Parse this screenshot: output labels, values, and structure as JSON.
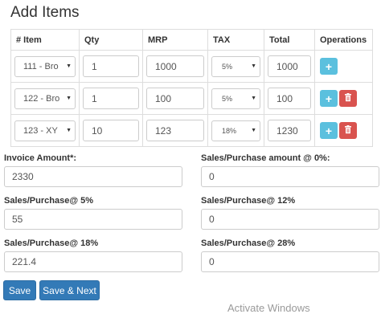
{
  "page": {
    "title": "Add Items"
  },
  "table": {
    "headers": [
      "# Item",
      "Qty",
      "MRP",
      "TAX",
      "Total",
      "Operations"
    ],
    "rows": [
      {
        "item": "111 - Bro",
        "qty": "1",
        "mrp": "1000",
        "tax": "5%",
        "total": "1000",
        "show_delete": false
      },
      {
        "item": "122 - Bro",
        "qty": "1",
        "mrp": "100",
        "tax": "5%",
        "total": "100",
        "show_delete": true
      },
      {
        "item": "123 - XY",
        "qty": "10",
        "mrp": "123",
        "tax": "18%",
        "total": "1230",
        "show_delete": true
      }
    ],
    "add_label": "+"
  },
  "form": {
    "invoice_amount": {
      "label": "Invoice Amount*:",
      "value": "2330"
    },
    "sales_0": {
      "label": "Sales/Purchase amount @ 0%:",
      "value": "0"
    },
    "sales_5": {
      "label": "Sales/Purchase@ 5%",
      "value": "55"
    },
    "sales_12": {
      "label": "Sales/Purchase@ 12%",
      "value": "0"
    },
    "sales_18": {
      "label": "Sales/Purchase@ 18%",
      "value": "221.4"
    },
    "sales_28": {
      "label": "Sales/Purchase@ 28%",
      "value": "0"
    }
  },
  "buttons": {
    "save": "Save",
    "save_next": "Save & Next"
  },
  "watermark": "Activate Windows",
  "colors": {
    "add": "#5bc0de",
    "delete": "#d9534f",
    "primary": "#337ab7"
  }
}
